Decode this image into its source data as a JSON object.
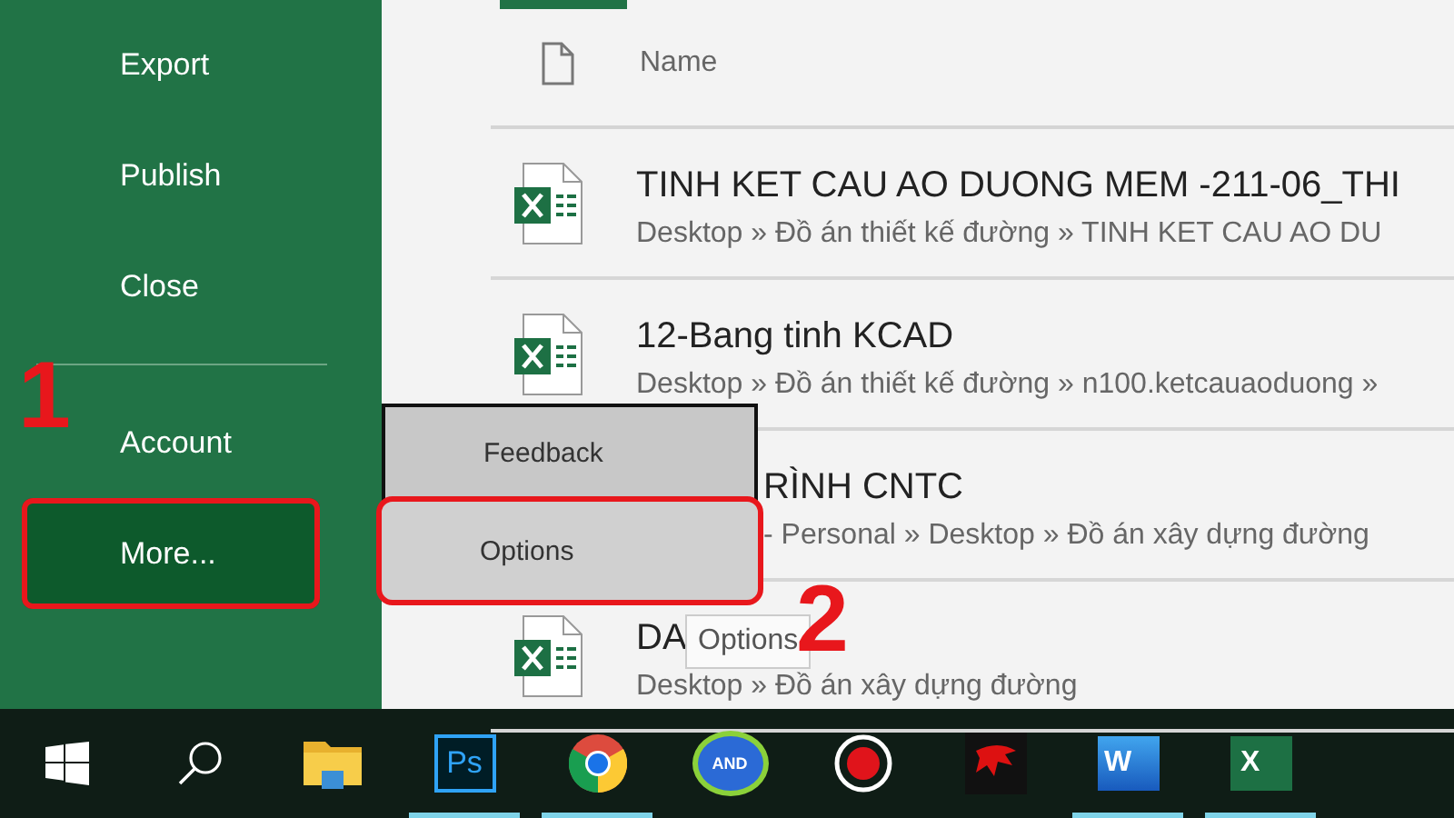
{
  "sidebar": {
    "items": [
      {
        "kind": "item",
        "label": "Export",
        "selected": false,
        "highlighted": false
      },
      {
        "kind": "item",
        "label": "Publish",
        "selected": false,
        "highlighted": false
      },
      {
        "kind": "item",
        "label": "Close",
        "selected": false,
        "highlighted": false
      },
      {
        "kind": "separator"
      },
      {
        "kind": "item",
        "label": "Account",
        "selected": false,
        "highlighted": false
      },
      {
        "kind": "item",
        "label": "More...",
        "selected": true,
        "highlighted": true
      }
    ]
  },
  "file_list": {
    "header": "Name",
    "files": [
      {
        "title": "TINH KET CAU AO DUONG MEM -211-06_THI",
        "path": "Desktop » Đồ án thiết kế đường » TINH KET CAU AO DU",
        "covered": false
      },
      {
        "title": "12-Bang tinh KCAD",
        "path": "Desktop » Đồ án thiết kế đường » n100.ketcauaoduong »",
        "covered": false
      },
      {
        "title": "RÌNH CNTC",
        "path": "- Personal » Desktop » Đồ án xây dựng đường",
        "covered": true
      },
      {
        "title": "DA",
        "path": "Desktop » Đồ án xây dựng đường",
        "covered": false
      }
    ]
  },
  "popup_menu": {
    "items": [
      {
        "label": "Feedback",
        "selected": false,
        "highlighted": false
      },
      {
        "label": "Options",
        "selected": true,
        "highlighted": true
      }
    ]
  },
  "tooltip": "Options",
  "step_labels": [
    "1",
    "2"
  ],
  "taskbar": {
    "items": [
      {
        "kind": "start",
        "running": false
      },
      {
        "kind": "search",
        "running": false
      },
      {
        "kind": "folder",
        "running": false
      },
      {
        "kind": "photoshop",
        "glyph": "Ps",
        "running": true
      },
      {
        "kind": "browser",
        "running": true
      },
      {
        "kind": "oval",
        "glyph": "AND",
        "running": false
      },
      {
        "kind": "record",
        "running": false
      },
      {
        "kind": "dragon",
        "running": false
      },
      {
        "kind": "word",
        "glyph": "W",
        "running": true
      },
      {
        "kind": "excel",
        "glyph": "X",
        "running": true
      }
    ]
  }
}
